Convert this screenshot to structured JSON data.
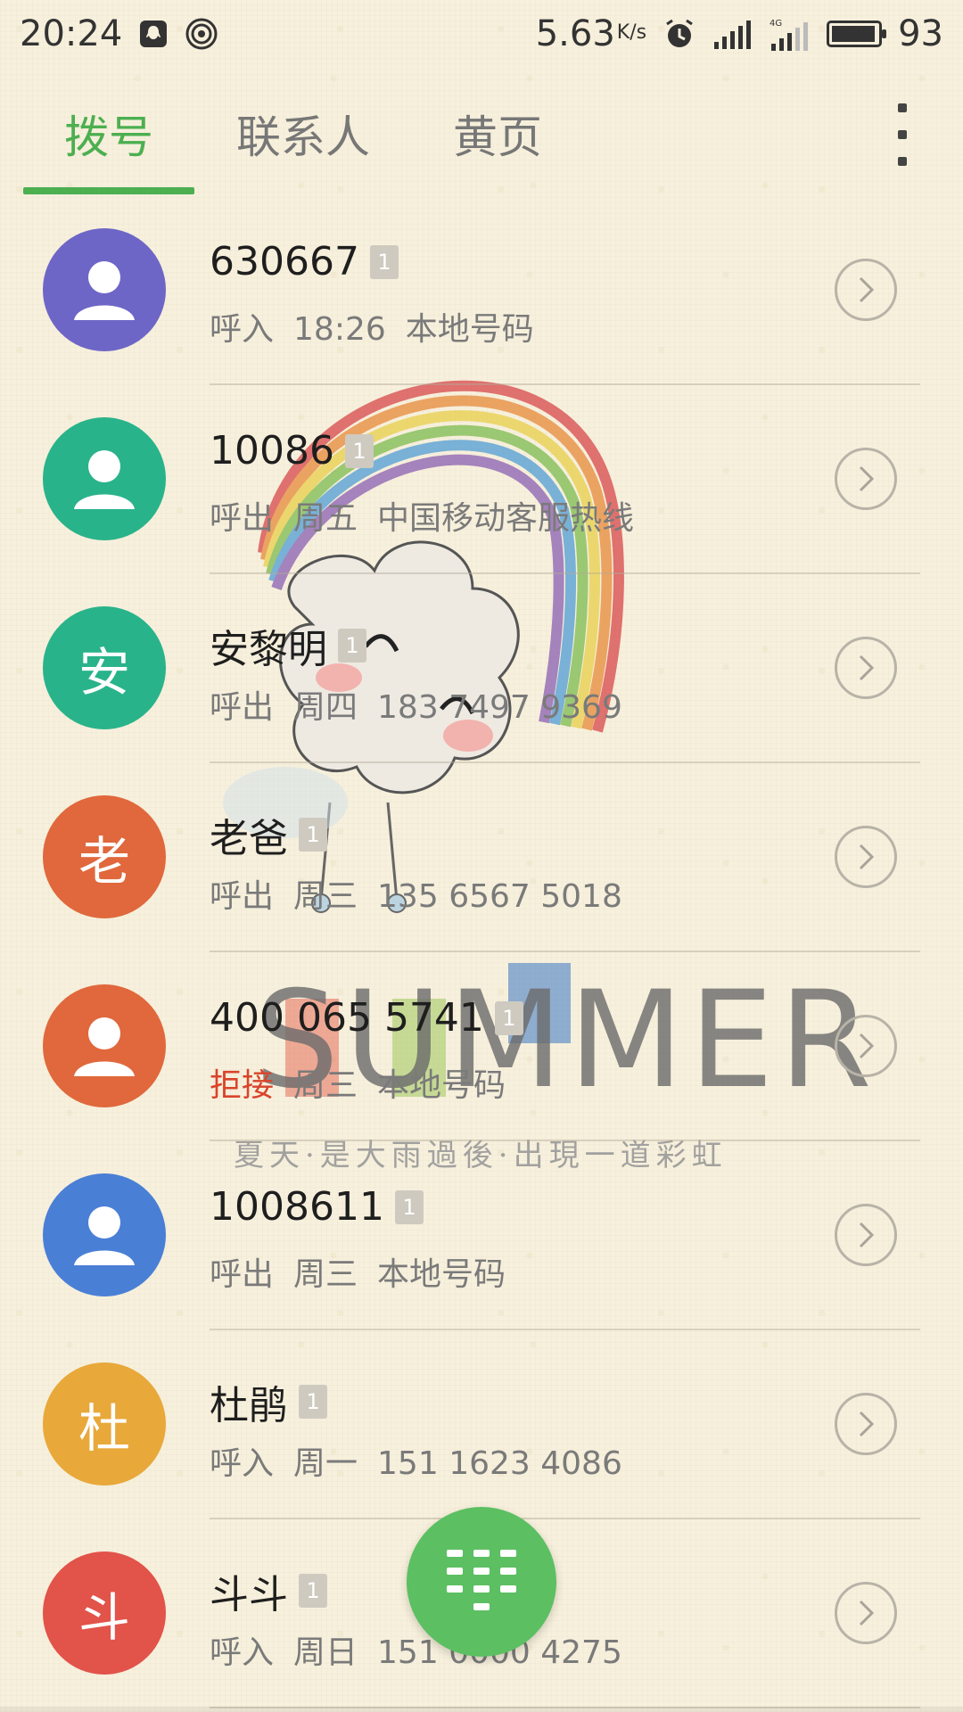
{
  "status_bar": {
    "time": "20:24",
    "speed": "5.63",
    "speed_unit": "K/s",
    "network": "4G",
    "battery": "93",
    "icons": [
      "qq-notification-icon",
      "hotspot-icon",
      "alarm-icon",
      "signal-icon",
      "signal-4g-icon",
      "battery-icon"
    ]
  },
  "tabs": [
    {
      "label": "拨号",
      "active": true
    },
    {
      "label": "联系人",
      "active": false
    },
    {
      "label": "黄页",
      "active": false
    }
  ],
  "wallpaper": {
    "title": "SUMMER",
    "subtitle": "夏天·是大雨過後·出現一道彩虹"
  },
  "calls": [
    {
      "name": "630667",
      "avatar_type": "person",
      "avatar_color": "#6e66c6",
      "sim": "1",
      "type": "呼入",
      "time": "18:26",
      "info": "本地号码",
      "missed": false
    },
    {
      "name": "10086",
      "avatar_type": "person",
      "avatar_color": "#29b38a",
      "sim": "1",
      "type": "呼出",
      "time": "周五",
      "info": "中国移动客服热线",
      "missed": false
    },
    {
      "name": "安黎明",
      "avatar_type": "letter",
      "avatar_letter": "安",
      "avatar_color": "#29b38a",
      "sim": "1",
      "type": "呼出",
      "time": "周四",
      "info": "183 7497 9369",
      "missed": false
    },
    {
      "name": "老爸",
      "avatar_type": "letter",
      "avatar_letter": "老",
      "avatar_color": "#e0683c",
      "sim": "1",
      "type": "呼出",
      "time": "周三",
      "info": "135 6567 5018",
      "missed": false
    },
    {
      "name": "400 065 5741",
      "avatar_type": "person",
      "avatar_color": "#e0683c",
      "sim": "1",
      "type": "拒接",
      "time": "周三",
      "info": "本地号码",
      "missed": true
    },
    {
      "name": "1008611",
      "avatar_type": "person",
      "avatar_color": "#4a7fd6",
      "sim": "1",
      "type": "呼出",
      "time": "周三",
      "info": "本地号码",
      "missed": false
    },
    {
      "name": "杜鹃",
      "avatar_type": "letter",
      "avatar_letter": "杜",
      "avatar_color": "#e8a83a",
      "sim": "1",
      "type": "呼入",
      "time": "周一",
      "info": "151 1623 4086",
      "missed": false
    },
    {
      "name": "斗斗",
      "avatar_type": "letter",
      "avatar_letter": "斗",
      "avatar_color": "#e2534a",
      "sim": "1",
      "type": "呼入",
      "time": "周日",
      "info": "151 0000 4275",
      "missed": false
    }
  ],
  "fab": {
    "icon": "dialpad-icon"
  }
}
